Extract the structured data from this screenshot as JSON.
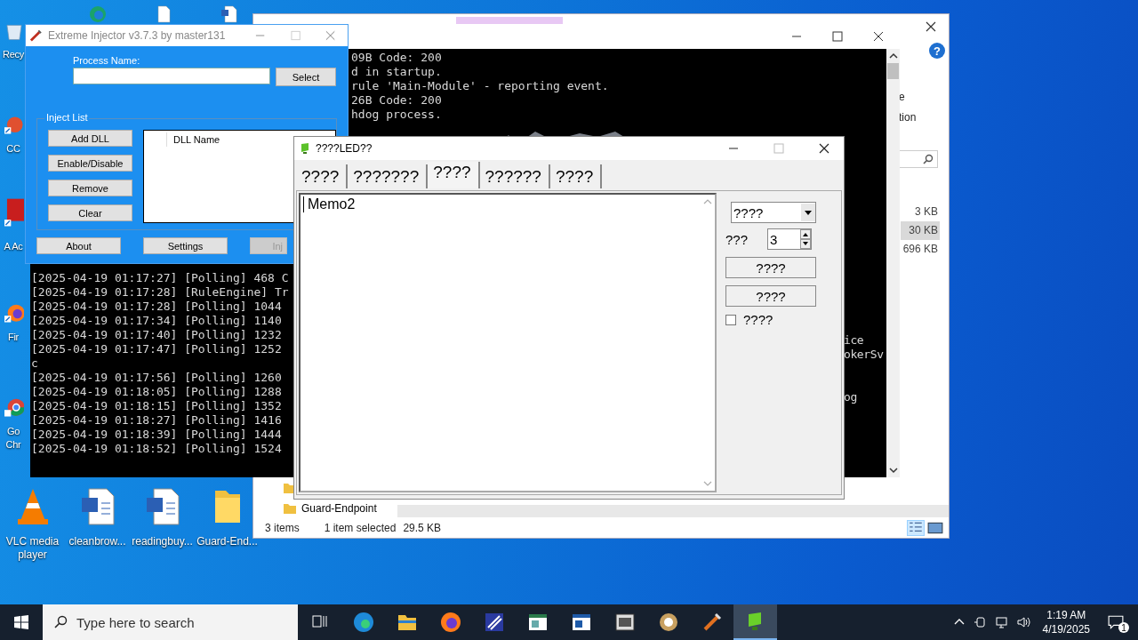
{
  "desktop_top_icons": [
    {
      "kind": "edge"
    },
    {
      "kind": "doc"
    },
    {
      "kind": "word"
    }
  ],
  "desktop_left_icons": [
    {
      "kind": "recycle",
      "label": "Recy"
    },
    {
      "kind": "cc",
      "label": "CC"
    },
    {
      "kind": "acrobat",
      "label": "A Ac"
    },
    {
      "kind": "firefox",
      "label": "Fir"
    },
    {
      "kind": "chrome",
      "label": "Go Chr"
    }
  ],
  "desktop_bottom_icons": [
    {
      "kind": "vlc",
      "label": "VLC media player"
    },
    {
      "kind": "word",
      "label": "cleanbrow..."
    },
    {
      "kind": "word",
      "label": "readingbuy..."
    },
    {
      "kind": "folder",
      "label": "Guard-End..."
    }
  ],
  "explorer": {
    "help": "?",
    "ribbon_fragments": [
      "e",
      "tion"
    ],
    "files": [
      {
        "size": "3 KB",
        "selected": false
      },
      {
        "size": "30 KB",
        "selected": true
      },
      {
        "size": "696 KB",
        "selected": false
      }
    ],
    "nav_items": [
      {
        "label": "Guard-Endpoint"
      }
    ],
    "status_bar": {
      "count": "3 items",
      "selection": "1 item selected",
      "size": "29.5 KB"
    }
  },
  "console_main": {
    "lines": [
      "09B Code: 200",
      "d in startup.",
      "rule 'Main-Module' - reporting event.",
      "26B Code: 200",
      "hdog process."
    ],
    "right_fragments": [
      "ice",
      "okerSv",
      "og"
    ]
  },
  "console_log": {
    "lines": [
      "[2025-04-19 01:17:27] [Polling] 468 C",
      "[2025-04-19 01:17:28] [RuleEngine] Tr",
      "[2025-04-19 01:17:28] [Polling] 1044",
      "[2025-04-19 01:17:34] [Polling] 1140",
      "[2025-04-19 01:17:40] [Polling] 1232",
      "[2025-04-19 01:17:47] [Polling] 1252",
      "c",
      "[2025-04-19 01:17:56] [Polling] 1260",
      "[2025-04-19 01:18:05] [Polling] 1288",
      "[2025-04-19 01:18:15] [Polling] 1352",
      "[2025-04-19 01:18:27] [Polling] 1416",
      "[2025-04-19 01:18:39] [Polling] 1444",
      "[2025-04-19 01:18:52] [Polling] 1524"
    ]
  },
  "injector": {
    "title": "Extreme Injector v3.7.3 by master131",
    "process_label": "Process Name:",
    "select_button": "Select",
    "group_title": "Inject List",
    "list_buttons": [
      "Add DLL",
      "Enable/Disable",
      "Remove",
      "Clear"
    ],
    "list_header": "DLL Name",
    "bottom_buttons": [
      {
        "label": "About",
        "disabled": false
      },
      {
        "label": "Settings",
        "disabled": false
      },
      {
        "label": "Inj",
        "disabled": true
      }
    ]
  },
  "led_window": {
    "title": "????LED??",
    "tabs": [
      {
        "label": "????",
        "selected": false
      },
      {
        "label": "???????",
        "selected": false
      },
      {
        "label": "????",
        "selected": true
      },
      {
        "label": "??????",
        "selected": false
      },
      {
        "label": "????",
        "selected": false
      }
    ],
    "memo": "Memo2",
    "combo": "????",
    "spin_label": "???",
    "spin_value": "3",
    "buttons": [
      "????",
      "????"
    ],
    "checkbox": {
      "label": "????",
      "checked": false
    }
  },
  "taskbar": {
    "search_placeholder": "Type here to search",
    "apps": [
      {
        "kind": "taskview",
        "selected": false
      },
      {
        "kind": "edge",
        "selected": false
      },
      {
        "kind": "explorer",
        "selected": false
      },
      {
        "kind": "firefox",
        "selected": false
      },
      {
        "kind": "tool",
        "selected": false
      },
      {
        "kind": "window",
        "selected": false
      },
      {
        "kind": "window2",
        "selected": false
      },
      {
        "kind": "pe",
        "selected": false
      },
      {
        "kind": "disc",
        "selected": false
      },
      {
        "kind": "injector",
        "selected": false
      },
      {
        "kind": "led",
        "selected": true
      }
    ],
    "time": "1:19 AM",
    "date": "4/19/2025",
    "notifications": "1"
  }
}
